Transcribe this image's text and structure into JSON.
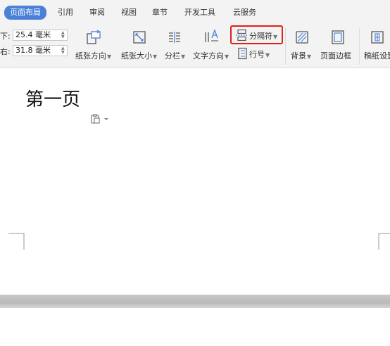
{
  "tabs": [
    {
      "label": "页面布局",
      "active": true
    },
    {
      "label": "引用"
    },
    {
      "label": "审阅"
    },
    {
      "label": "视图"
    },
    {
      "label": "章节"
    },
    {
      "label": "开发工具"
    },
    {
      "label": "云服务"
    }
  ],
  "margins": {
    "bottom_label": "下:",
    "bottom_value": "25.4 毫米",
    "right_label": "右:",
    "right_value": "31.8 毫米"
  },
  "ribbon": {
    "orientation": "纸张方向",
    "paper_size": "纸张大小",
    "columns": "分栏",
    "text_direction": "文字方向",
    "breaks": "分隔符",
    "line_numbers": "行号",
    "background": "背景",
    "page_border": "页面边框",
    "manuscript": "稿纸设置"
  },
  "document": {
    "text": "第一页"
  },
  "colors": {
    "accent": "#4a80d8",
    "highlight": "#e0201b"
  }
}
